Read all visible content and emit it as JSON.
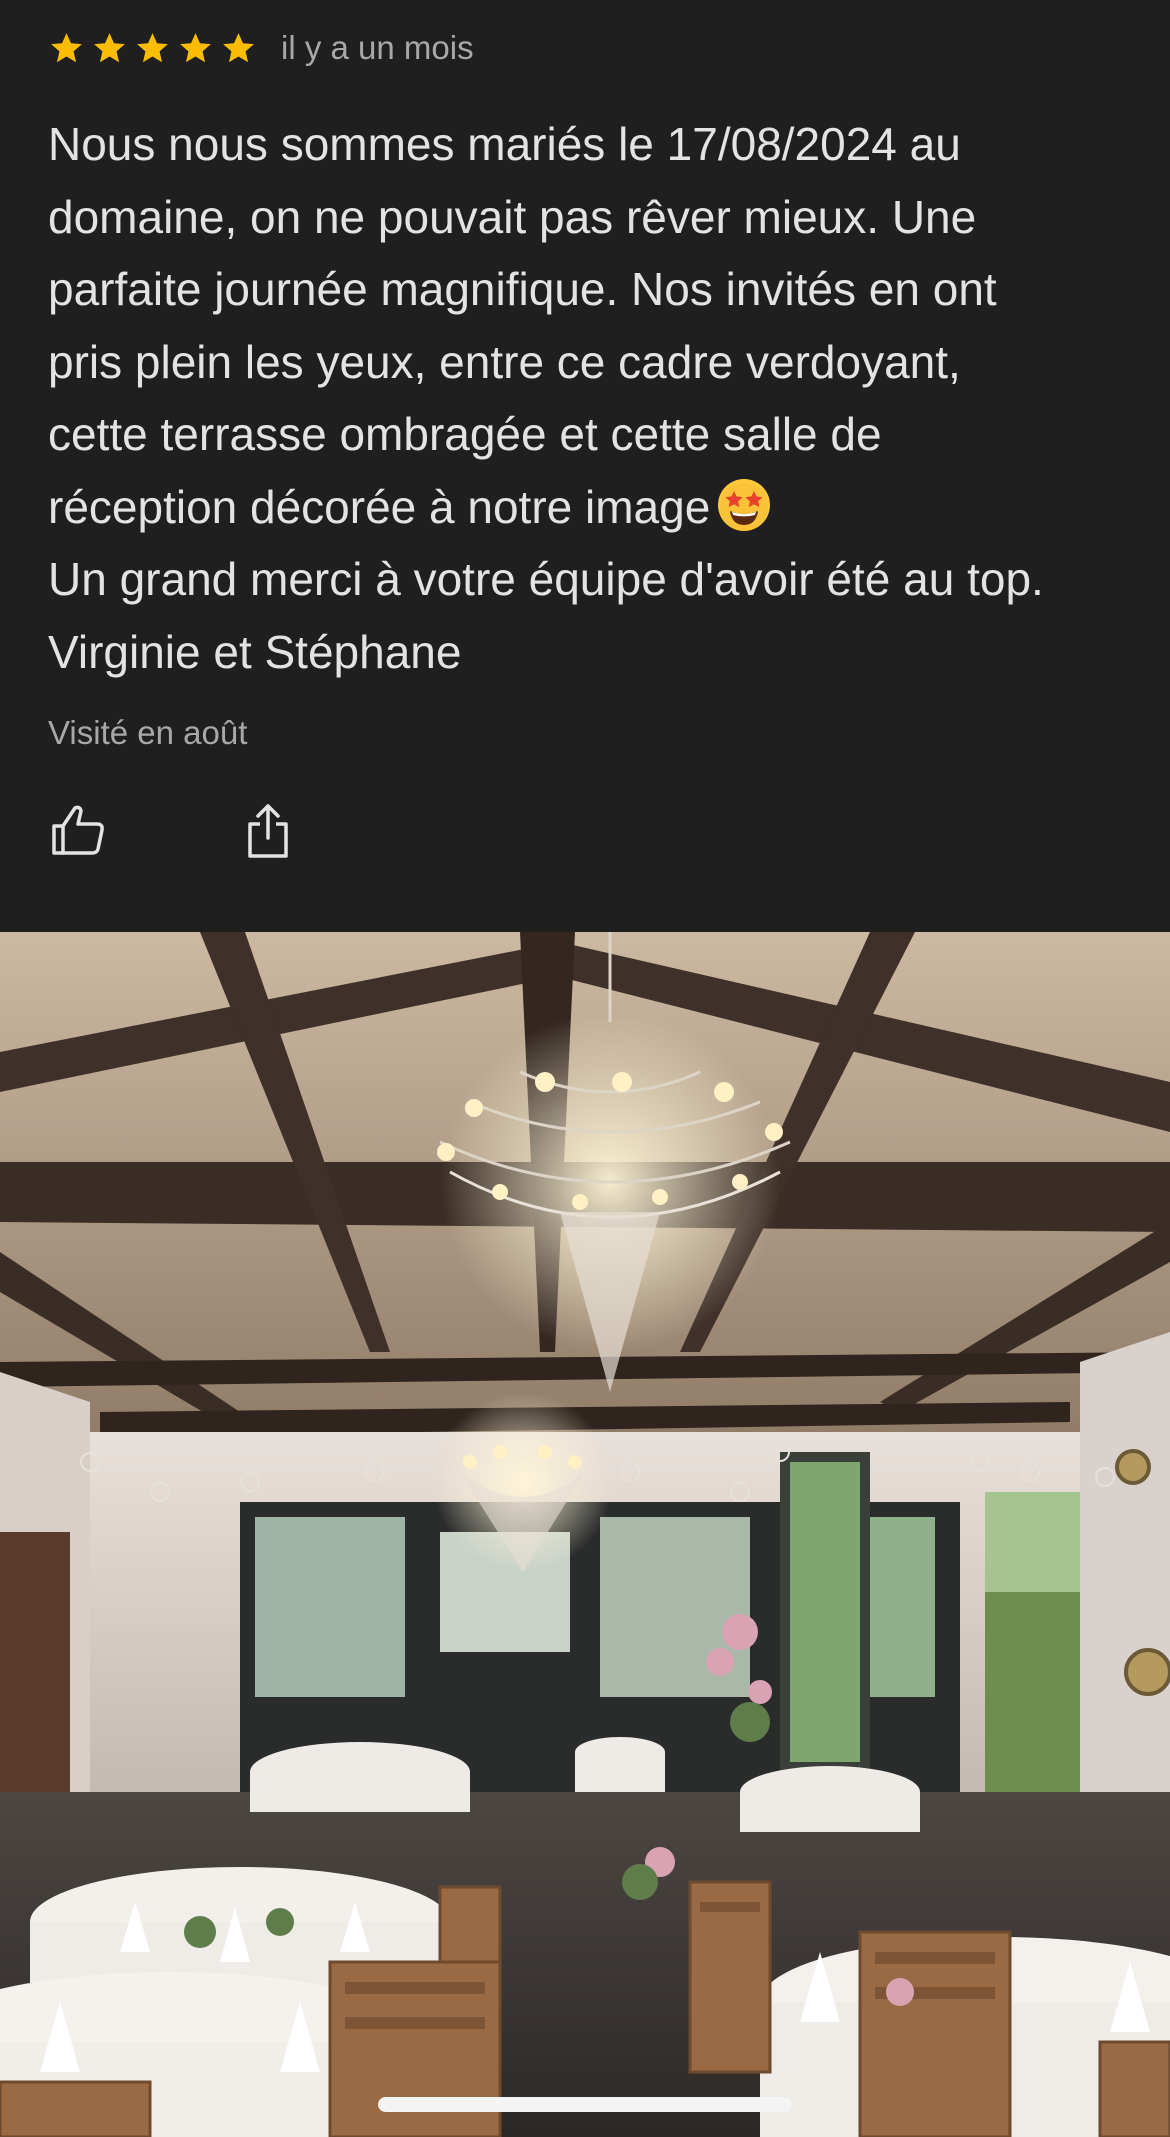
{
  "review": {
    "rating": 5,
    "rating_max": 5,
    "star_color": "#fbbc04",
    "time_ago": "il y a un mois",
    "text_part1": "Nous nous sommes mariés le 17/08/2024 au\ndomaine, on ne pouvait pas rêver mieux. Une\nparfaite journée magnifique. Nos invités en ont\npris plein les yeux, entre ce cadre verdoyant,\ncette terrasse ombragée et cette salle de\nréception décorée à notre image",
    "emoji": "star-struck-emoji",
    "text_part2": "Un grand merci à votre équipe d'avoir été au top.\nVirginie et Stéphane",
    "visited": "Visité en août"
  },
  "actions": {
    "like_icon": "thumbs-up-icon",
    "share_icon": "share-icon"
  },
  "photo": {
    "subject": "reception-hall-photo"
  }
}
